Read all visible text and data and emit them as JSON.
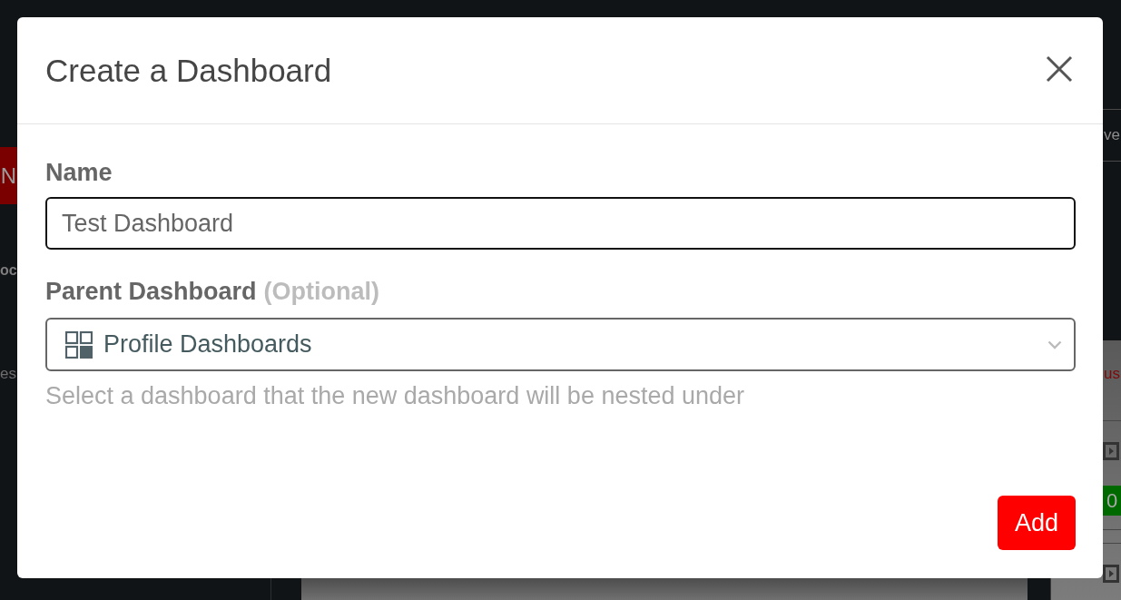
{
  "background": {
    "left": {
      "button": "N",
      "heading": "oc",
      "text": "es"
    },
    "right": {
      "tab": "ve",
      "panel_title": "us",
      "badge": "0"
    }
  },
  "dialog": {
    "title": "Create a Dashboard",
    "fields": [
      {
        "kind": "text",
        "label": "Name",
        "value": "Test Dashboard",
        "focused": true
      },
      {
        "kind": "select",
        "label": "Parent Dashboard",
        "label_note": "(Optional)",
        "value": "Profile Dashboards",
        "help": "Select a dashboard that the new dashboard will be nested under",
        "focused": false
      }
    ],
    "buttons": [
      {
        "label": "Add"
      }
    ]
  }
}
